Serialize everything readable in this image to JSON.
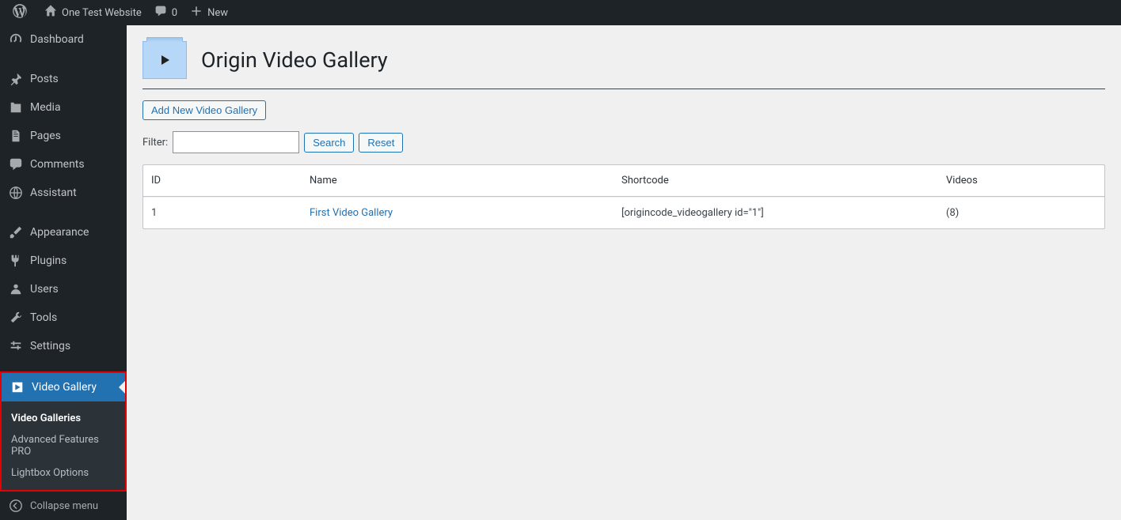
{
  "toolbar": {
    "site_name": "One Test Website",
    "comments_count": "0",
    "new_label": "New"
  },
  "sidebar": {
    "items": [
      {
        "label": "Dashboard"
      },
      {
        "label": "Posts"
      },
      {
        "label": "Media"
      },
      {
        "label": "Pages"
      },
      {
        "label": "Comments"
      },
      {
        "label": "Assistant"
      },
      {
        "label": "Appearance"
      },
      {
        "label": "Plugins"
      },
      {
        "label": "Users"
      },
      {
        "label": "Tools"
      },
      {
        "label": "Settings"
      },
      {
        "label": "Video Gallery"
      }
    ],
    "submenu": [
      {
        "label": "Video Galleries"
      },
      {
        "label": "Advanced Features PRO"
      },
      {
        "label": "Lightbox Options"
      }
    ],
    "collapse_label": "Collapse menu"
  },
  "page": {
    "title": "Origin Video Gallery",
    "add_button": "Add New Video Gallery",
    "filter_label": "Filter:",
    "search_btn": "Search",
    "reset_btn": "Reset"
  },
  "table": {
    "headers": {
      "id": "ID",
      "name": "Name",
      "shortcode": "Shortcode",
      "videos": "Videos"
    },
    "rows": [
      {
        "id": "1",
        "name": "First Video Gallery",
        "shortcode": "[origincode_videogallery id=\"1\"]",
        "videos": "(8)"
      }
    ]
  }
}
